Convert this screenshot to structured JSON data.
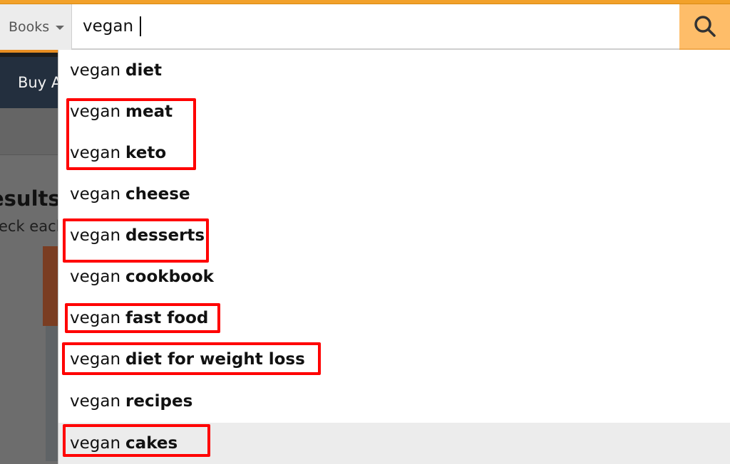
{
  "search": {
    "category": "Books",
    "query": "vegan",
    "button_icon": "search-icon"
  },
  "background": {
    "subnav_label": "Buy A",
    "results_title": "esults",
    "results_subtitle": "eck each"
  },
  "suggestions": [
    {
      "prefix": "vegan",
      "completion": "diet",
      "highlighted": false,
      "active": false
    },
    {
      "prefix": "vegan",
      "completion": "meat",
      "highlighted": true,
      "active": false
    },
    {
      "prefix": "vegan",
      "completion": "keto",
      "highlighted": true,
      "active": false
    },
    {
      "prefix": "vegan",
      "completion": "cheese",
      "highlighted": false,
      "active": false
    },
    {
      "prefix": "vegan",
      "completion": "desserts",
      "highlighted": true,
      "active": false
    },
    {
      "prefix": "vegan",
      "completion": "cookbook",
      "highlighted": false,
      "active": false
    },
    {
      "prefix": "vegan",
      "completion": "fast food",
      "highlighted": true,
      "active": false
    },
    {
      "prefix": "vegan",
      "completion": "diet for weight loss",
      "highlighted": true,
      "active": false
    },
    {
      "prefix": "vegan",
      "completion": "recipes",
      "highlighted": false,
      "active": false
    },
    {
      "prefix": "vegan",
      "completion": "cakes",
      "highlighted": true,
      "active": true
    }
  ],
  "colors": {
    "accent": "#febd69",
    "highlight_box": "#ff0000",
    "nav_bg": "#232f3e"
  }
}
